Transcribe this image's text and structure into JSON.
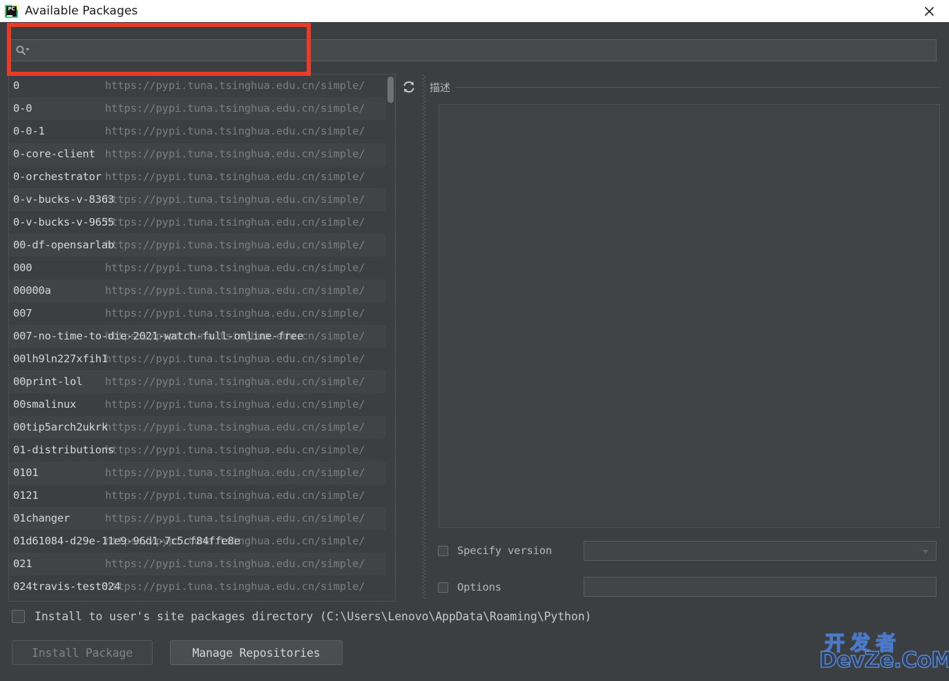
{
  "window": {
    "title": "Available Packages",
    "app_icon": "pycharm-icon",
    "icon_label": "PC",
    "close_icon": "close-icon"
  },
  "search": {
    "icon": "search-icon",
    "dropdown_icon": "chevron-down-icon",
    "value": "",
    "placeholder": ""
  },
  "toolbar": {
    "refresh_icon": "refresh-icon"
  },
  "package_list": {
    "repository_url": "https://pypi.tuna.tsinghua.edu.cn/simple/",
    "packages": [
      "0",
      "0-0",
      "0-0-1",
      "0-core-client",
      "0-orchestrator",
      "0-v-bucks-v-8363",
      "0-v-bucks-v-9655",
      "00-df-opensarlab",
      "000",
      "00000a",
      "007",
      "007-no-time-to-die-2021-watch-full-online-free",
      "00lh9ln227xfih1",
      "00print-lol",
      "00smalinux",
      "00tip5arch2ukrk",
      "01-distributions",
      "0101",
      "0121",
      "01changer",
      "01d61084-d29e-11e9-96d1-7c5cf84ffe8e",
      "021",
      "024travis-test024"
    ]
  },
  "details": {
    "description_title": "描述",
    "description_text": "",
    "specify_version": {
      "label": "Specify version",
      "checked": false,
      "value": ""
    },
    "options": {
      "label": "Options",
      "checked": false,
      "value": ""
    }
  },
  "footer": {
    "install_user_site": {
      "label": "Install to user's site packages directory (C:\\Users\\Lenovo\\AppData\\Roaming\\Python)",
      "checked": false
    },
    "install_button": "Install Package",
    "install_button_enabled": false,
    "manage_repositories_button": "Manage Repositories"
  },
  "watermark": {
    "top": "开发者",
    "bottom": "DevZe.CoM",
    "mark": "c"
  },
  "colors": {
    "window_bg": "#3c3f41",
    "titlebar_bg": "#ffffff",
    "annotation": "#ec3a27",
    "text_primary": "#d8d8d8",
    "text_muted": "#7b7f81"
  }
}
